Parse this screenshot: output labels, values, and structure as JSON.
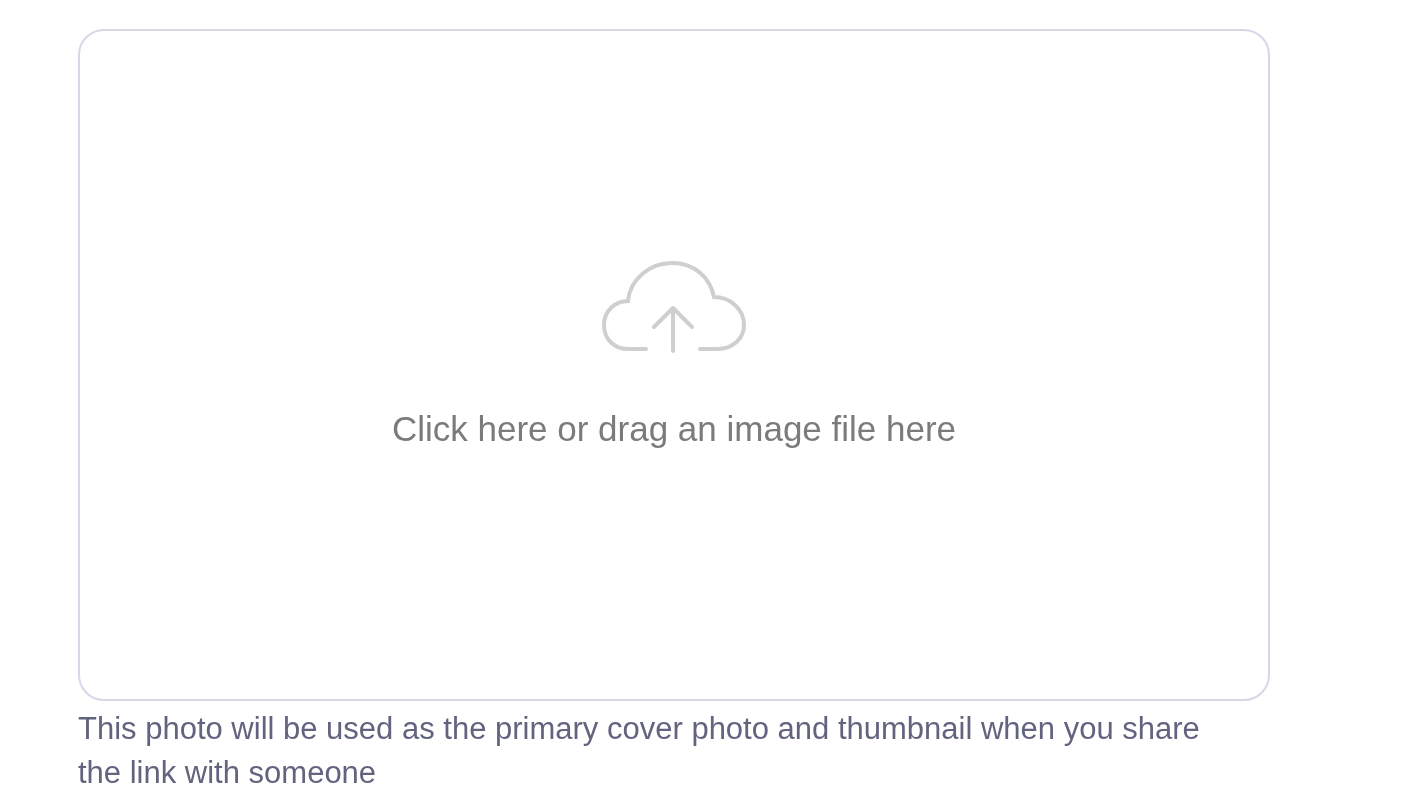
{
  "upload": {
    "prompt": "Click here or drag an image file here"
  },
  "help_text": "This photo will be used as the primary cover photo and thumbnail when you share the link with someone"
}
